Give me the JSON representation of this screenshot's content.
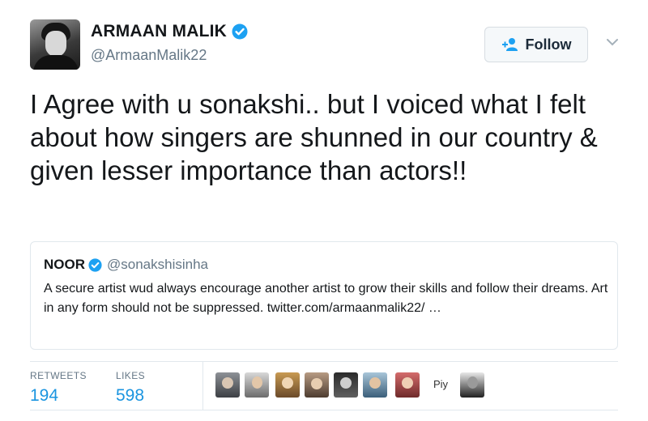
{
  "tweet": {
    "author": {
      "display_name": "ARMAAN MALIK",
      "handle": "@ArmaanMalik22",
      "verified": true,
      "avatar": "avatar-photo"
    },
    "follow_button": {
      "label": "Follow",
      "icon": "follow-user-icon"
    },
    "menu_icon": "chevron-down-icon",
    "text": "I Agree with u sonakshi.. but I voiced what I felt about how singers are shunned in our country & given lesser importance than actors!!",
    "quoted": {
      "display_name": "NOOR",
      "verified": true,
      "handle": "@sonakshisinha",
      "text": "A secure artist wud always encourage another artist to grow their skills and follow their dreams. Art in any form should not be suppressed. twitter.com/armaanmalik22/ …"
    },
    "stats": {
      "retweets_label": "RETWEETS",
      "retweets_value": "194",
      "likes_label": "LIKES",
      "likes_value": "598"
    },
    "likers": {
      "count_shown": 9,
      "partial_label": "Piy"
    }
  },
  "colors": {
    "link_blue": "#1b95e0",
    "verified_blue": "#1da1f2",
    "muted_gray": "#657786",
    "text": "#14171a",
    "border": "#e1e8ed"
  }
}
